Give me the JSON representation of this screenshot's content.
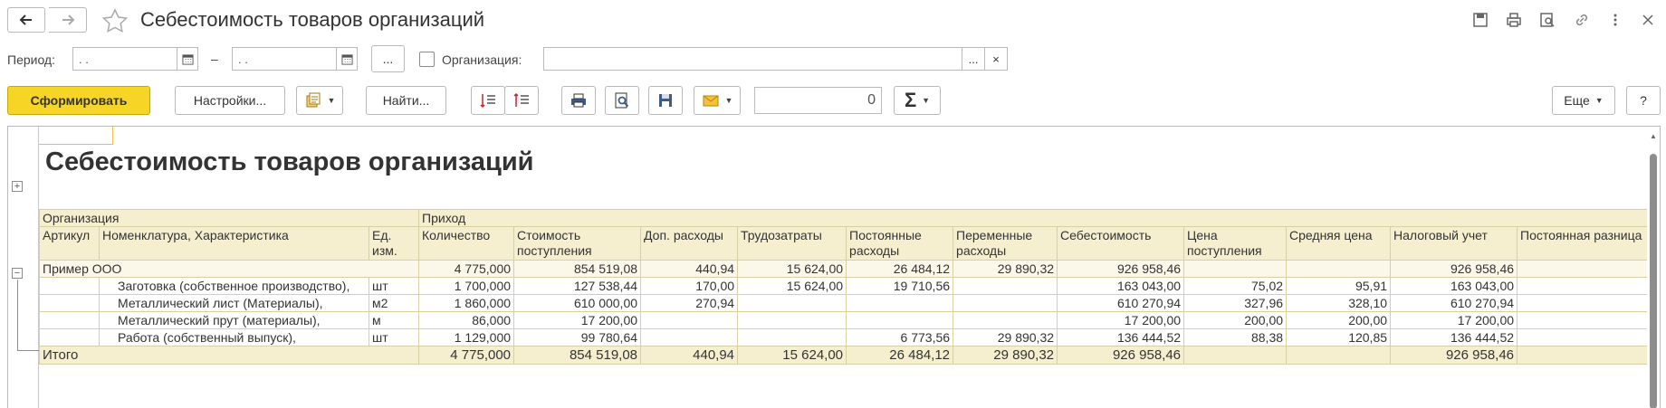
{
  "window": {
    "title": "Себестоимость товаров организаций"
  },
  "filters": {
    "period_label": "Период:",
    "date_from_placeholder": ". .",
    "date_to_placeholder": ". .",
    "dash": "–",
    "ellipsis_label": "...",
    "org_label": "Организация:",
    "org_value": "",
    "org_select_label": "...",
    "org_clear_label": "×"
  },
  "toolbar": {
    "generate_label": "Сформировать",
    "settings_label": "Настройки...",
    "find_label": "Найти...",
    "sum_value": "0",
    "more_label": "Еще",
    "help_label": "?"
  },
  "report": {
    "title": "Себестоимость товаров организаций",
    "header1": {
      "org": "Организация",
      "income": "Приход"
    },
    "header2": [
      "Артикул",
      "Номенклатура, Характеристика",
      "Ед. изм.",
      "Количество",
      "Стоимость поступления",
      "Доп. расходы",
      "Трудозатраты",
      "Постоянные расходы",
      "Переменные расходы",
      "Себестоимость",
      "Цена поступления",
      "Средняя цена",
      "Налоговый учет",
      "Постоянная разница"
    ],
    "group": {
      "name": "Пример ООО",
      "values": [
        "4 775,000",
        "854 519,08",
        "440,94",
        "15 624,00",
        "26 484,12",
        "29 890,32",
        "926 958,46",
        "",
        "",
        "926 958,46",
        ""
      ]
    },
    "rows": [
      {
        "article": "",
        "name": "Заготовка (собственное производство),",
        "unit": "шт",
        "values": [
          "1 700,000",
          "127 538,44",
          "170,00",
          "15 624,00",
          "19 710,56",
          "",
          "163 043,00",
          "75,02",
          "95,91",
          "163 043,00",
          ""
        ]
      },
      {
        "article": "",
        "name": "Металлический лист (Материалы),",
        "unit": "м2",
        "values": [
          "1 860,000",
          "610 000,00",
          "270,94",
          "",
          "",
          "",
          "610 270,94",
          "327,96",
          "328,10",
          "610 270,94",
          ""
        ]
      },
      {
        "article": "",
        "name": "Металлический прут (материалы),",
        "unit": "м",
        "values": [
          "86,000",
          "17 200,00",
          "",
          "",
          "",
          "",
          "17 200,00",
          "200,00",
          "200,00",
          "17 200,00",
          ""
        ]
      },
      {
        "article": "",
        "name": "Работа (собственный выпуск),",
        "unit": "шт",
        "values": [
          "1 129,000",
          "99 780,64",
          "",
          "",
          "6 773,56",
          "29 890,32",
          "136 444,52",
          "88,38",
          "120,85",
          "136 444,52",
          ""
        ]
      }
    ],
    "total": {
      "label": "Итого",
      "values": [
        "4 775,000",
        "854 519,08",
        "440,94",
        "15 624,00",
        "26 484,12",
        "29 890,32",
        "926 958,46",
        "",
        "",
        "926 958,46",
        ""
      ]
    }
  }
}
